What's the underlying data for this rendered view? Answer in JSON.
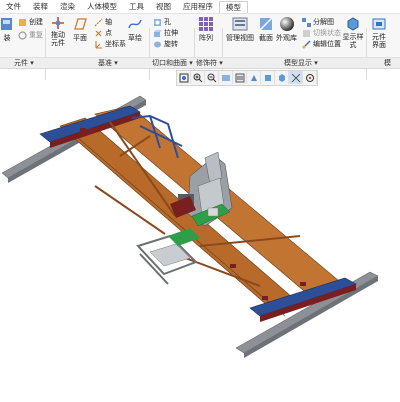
{
  "menu": [
    {
      "label": "文件",
      "active": false
    },
    {
      "label": "装释",
      "active": false
    },
    {
      "label": "渲染",
      "active": false
    },
    {
      "label": "人体模型",
      "active": false
    },
    {
      "label": "工具",
      "active": false
    },
    {
      "label": "视图",
      "active": false
    },
    {
      "label": "应用程序",
      "active": false
    },
    {
      "label": "模型",
      "active": true
    }
  ],
  "ribbon": {
    "yuanjian": {
      "zhuang": "装",
      "chuangjian": "创建",
      "chongfu": "重复"
    },
    "jizhun": {
      "tuozhuai": "拖动元件",
      "pingmian": "平面",
      "zhou": "轴",
      "dian": "点",
      "zuobiaoxi": "坐标系",
      "caohui": "草绘"
    },
    "qiekou": {
      "kong": "孔",
      "lashen": "拉伸",
      "xuanzhuan": "旋转"
    },
    "xiushi": {
      "zhenlie": "阵列"
    },
    "moxing": {
      "guanlishitu": "管理视图",
      "jiemian": "截面",
      "waiguan": "外观库",
      "fenjietu": "分解图",
      "qiehuanzhuangtai": "切换状态",
      "bianjiweizhi": "编辑位置"
    },
    "xianshi": {
      "xianshiyangshi": "显示样式",
      "yuanjianjiemian": "元件界面"
    }
  },
  "groups": {
    "g1": "元件 ▾",
    "g2": "基准 ▾",
    "g3": "切口和曲面 ▾",
    "g4": "修饰符 ▾",
    "g5": "模型显示 ▾",
    "g6": "模"
  },
  "icons": [
    "refit-icon",
    "zoom-in-icon",
    "zoom-out-icon",
    "repaint-icon",
    "view-manager-icon",
    "saved-views-icon",
    "named-view-icon",
    "display-style-icon",
    "datum-display-icon",
    "spin-center-icon"
  ],
  "colors": {
    "frame_orange": "#b86a2a",
    "rail_gray": "#8d9197",
    "trolley_gray": "#9aa0a6",
    "accent_green": "#2f9e49",
    "blue_beam": "#2c4f97",
    "dark_red": "#7a1f1f"
  }
}
